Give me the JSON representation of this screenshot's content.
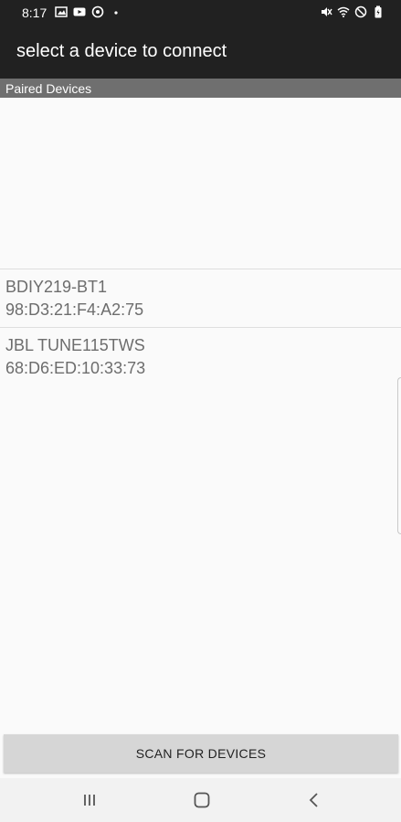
{
  "status_bar": {
    "time": "8:17",
    "left_icons": [
      "image-icon",
      "youtube-icon",
      "target-icon",
      "dot-icon"
    ],
    "right_icons": [
      "mute-icon",
      "wifi-icon",
      "dnd-icon",
      "battery-icon"
    ]
  },
  "app_bar": {
    "title": "select a device to connect"
  },
  "paired": {
    "header": "Paired Devices",
    "devices": [
      {
        "name": "BDIY219-BT1",
        "address": "98:D3:21:F4:A2:75"
      },
      {
        "name": "JBL TUNE115TWS",
        "address": "68:D6:ED:10:33:73"
      }
    ]
  },
  "scan_button": {
    "label": "SCAN FOR DEVICES"
  },
  "nav_bar": {
    "icons": [
      "recents-icon",
      "home-icon",
      "back-icon"
    ]
  },
  "colors": {
    "app_bar_bg": "#212121",
    "section_header_bg": "#6f6f6f",
    "button_bg": "#d6d6d6",
    "device_text": "#6d6d6d"
  }
}
